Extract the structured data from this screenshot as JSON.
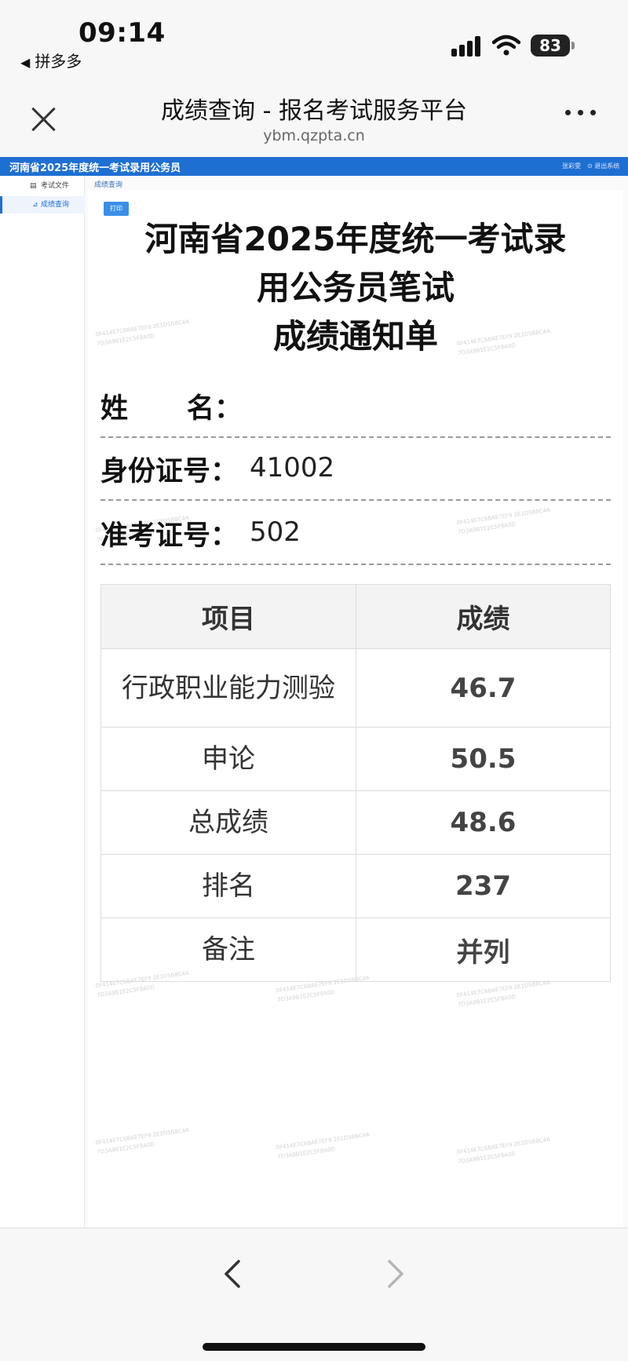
{
  "status_bar": {
    "time": "09:14",
    "back_app": "拼多多",
    "battery": "83"
  },
  "browser": {
    "page_title": "成绩查询 - 报名考试服务平台",
    "url": "ybm.qzpta.cn"
  },
  "site": {
    "title": "河南省2025年度统一考试录用公务员",
    "user_name": "张彩雯",
    "logout_label": "退出系统"
  },
  "sidebar": {
    "items": [
      {
        "label": "考试文件",
        "icon": "document-icon",
        "active": false
      },
      {
        "label": "成绩查询",
        "icon": "chart-icon",
        "active": true
      }
    ]
  },
  "content": {
    "breadcrumb": "成绩查询",
    "print_label": "打印",
    "doc_title_line1": "河南省2025年度统一考试录",
    "doc_title_line2": "用公务员笔试",
    "doc_title_line3": "成绩通知单",
    "name_label_a": "姓",
    "name_label_b": "名：",
    "name_value": "",
    "id_label": "身份证号：",
    "id_value": "41002",
    "ticket_label": "准考证号：",
    "ticket_value": "502",
    "table": {
      "headers": [
        "项目",
        "成绩"
      ],
      "rows": [
        {
          "item": "行政职业能力测验",
          "score": "46.7"
        },
        {
          "item": "申论",
          "score": "50.5"
        },
        {
          "item": "总成绩",
          "score": "48.6"
        },
        {
          "item": "排名",
          "score": "237"
        },
        {
          "item": "备注",
          "score": "并列"
        }
      ]
    }
  },
  "colors": {
    "brand_blue": "#1e6fd2",
    "print_button": "#3a8ee6"
  }
}
